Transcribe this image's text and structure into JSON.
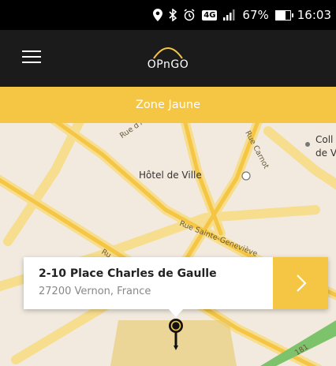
{
  "status_bar": {
    "battery": "67%",
    "time": "16:03",
    "network": "4G"
  },
  "app_bar": {
    "logo_text": "OPnGO"
  },
  "zone": {
    "label": "Zone Jaune",
    "color": "#f5c544"
  },
  "map": {
    "places": {
      "hotel_de_ville": "Hôtel de Ville",
      "coll": "Coll",
      "de_v": "de V"
    },
    "streets": {
      "albufera": "Rue d'Albufe",
      "carnot": "Rue Carnot",
      "sainte_genevieve": "Rue Sainte-Geneviève",
      "ru": "Ru",
      "num": "181"
    }
  },
  "address": {
    "street": "2-10 Place Charles de Gaulle",
    "city": "27200 Vernon, France"
  }
}
